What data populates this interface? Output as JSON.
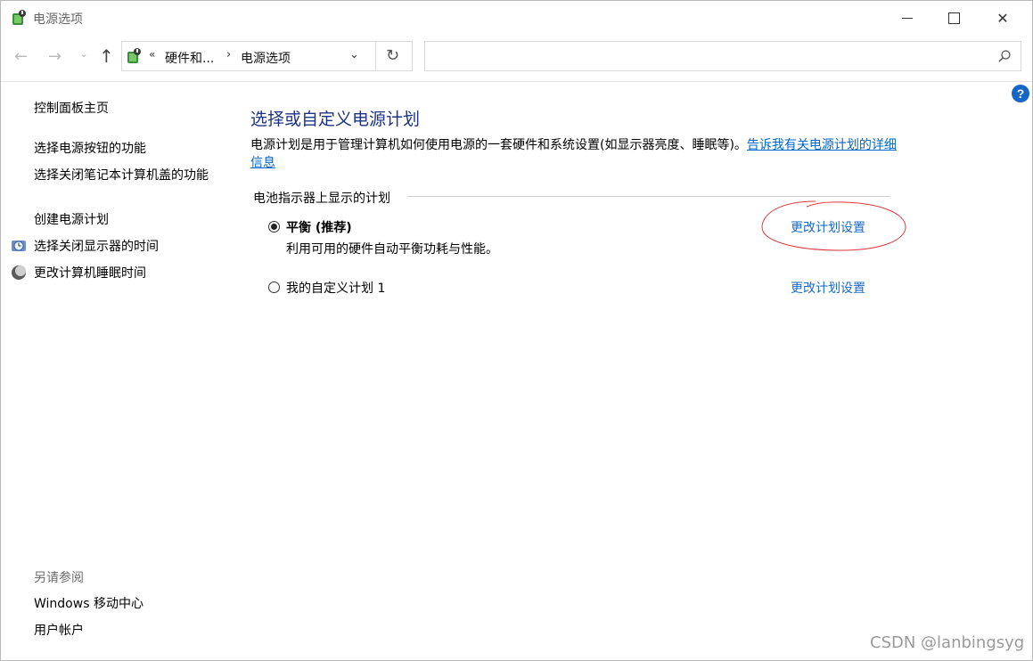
{
  "window": {
    "title": "电源选项",
    "controls": {
      "minimize": "minimize",
      "maximize": "maximize",
      "close": "✕"
    }
  },
  "nav": {
    "back": "←",
    "forward": "→",
    "recent": "⌄",
    "up": "↑",
    "address": {
      "chevron": "«",
      "crumb_parent": "硬件和...",
      "separator": "›",
      "crumb_current": "电源选项",
      "dropdown": "⌄",
      "refresh": "↻"
    },
    "search": {
      "placeholder": ""
    }
  },
  "help": {
    "label": "?"
  },
  "sidebar": {
    "home": "控制面板主页",
    "links": [
      "选择电源按钮的功能",
      "选择关闭笔记本计算机盖的功能",
      "创建电源计划",
      "选择关闭显示器的时间",
      "更改计算机睡眠时间"
    ],
    "see_also_heading": "另请参阅",
    "see_also": [
      "Windows 移动中心",
      "用户帐户"
    ]
  },
  "main": {
    "title": "选择或自定义电源计划",
    "description": "电源计划是用于管理计算机如何使用电源的一套硬件和系统设置(如显示器亮度、睡眠等)。",
    "description_link": "告诉我有关电源计划的详细信息",
    "group_label": "电池指示器上显示的计划",
    "plans": [
      {
        "name": "平衡 (推荐)",
        "description": "利用可用的硬件自动平衡功耗与性能。",
        "selected": true,
        "link": "更改计划设置"
      },
      {
        "name": "我的自定义计划 1",
        "selected": false,
        "link": "更改计划设置"
      }
    ]
  },
  "annotation_color": "#e0383b",
  "watermark": "CSDN @lanbingsyg"
}
